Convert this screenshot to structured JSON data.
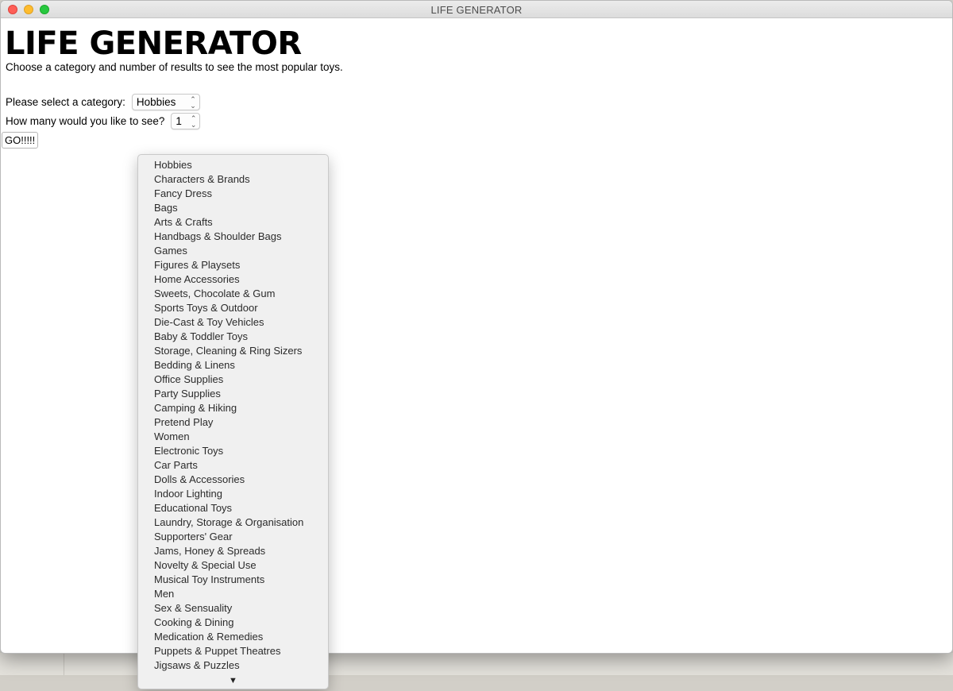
{
  "window": {
    "title": "LIFE GENERATOR"
  },
  "main": {
    "heading": "LIFE GENERATOR",
    "subtitle": "Choose a category and number of results to see the most popular toys.",
    "category_label": "Please select a category:",
    "category_selected": "Hobbies",
    "count_label": "How many would you like to see?",
    "count_selected": "1",
    "go_label": "GO!!!!!"
  },
  "dropdown": {
    "items": [
      "Hobbies",
      "Characters & Brands",
      "Fancy Dress",
      "Bags",
      "Arts & Crafts",
      "Handbags & Shoulder Bags",
      "Games",
      "Figures & Playsets",
      "Home Accessories",
      "Sweets, Chocolate & Gum",
      "Sports Toys & Outdoor",
      "Die-Cast & Toy Vehicles",
      "Baby & Toddler Toys",
      "Storage, Cleaning & Ring Sizers",
      "Bedding & Linens",
      "Office Supplies",
      "Party Supplies",
      "Camping & Hiking",
      "Pretend Play",
      "Women",
      "Electronic Toys",
      "Car Parts",
      "Dolls & Accessories",
      "Indoor Lighting",
      "Educational Toys",
      "Laundry, Storage & Organisation",
      "Supporters' Gear",
      "Jams, Honey & Spreads",
      "Novelty & Special Use",
      "Musical Toy Instruments",
      "Men",
      "Sex & Sensuality",
      "Cooking & Dining",
      "Medication & Remedies",
      "Puppets & Puppet Theatres",
      "Jigsaws & Puzzles"
    ],
    "scroll_arrow": "▼"
  },
  "icons": {
    "updown": "updown-chevron-icon",
    "scroll_down": "scroll-down-arrow-icon"
  },
  "colors": {
    "close": "#fe5f57",
    "minimize": "#febc2e",
    "zoom": "#28c840"
  }
}
